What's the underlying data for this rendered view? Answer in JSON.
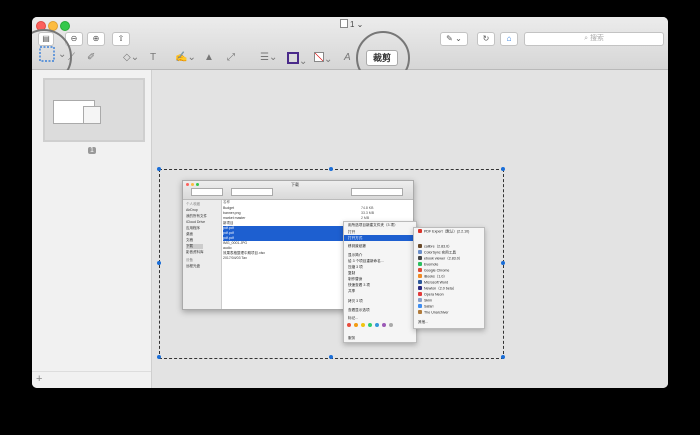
{
  "window": {
    "title": "1",
    "search_placeholder": "搜索",
    "crop_label": "裁剪",
    "page_number": "1",
    "add_symbol": "+"
  },
  "finder": {
    "title": "下载",
    "sidebar": [
      "个人收藏",
      "AirDrop",
      "我的所有文件",
      "iCloud Drive",
      "应用程序",
      "桌面",
      "文稿",
      "下载",
      "影音资料库",
      "设备",
      "远程光盘"
    ],
    "column_header": "名称",
    "files": [
      {
        "name": "Budget",
        "selected": false
      },
      {
        "name": "banner.png",
        "selected": false
      },
      {
        "name": "market master",
        "selected": false
      },
      {
        "name": "新项目",
        "selected": false
      },
      {
        "name": "pdf.pdf",
        "selected": true
      },
      {
        "name": "pdf.pdf",
        "selected": true
      },
      {
        "name": "pdf.pdf",
        "selected": true
      },
      {
        "name": "IMG_0001.JPG",
        "selected": false
      },
      {
        "name": "audio",
        "selected": false
      },
      {
        "name": "效果表格整理中期项目.xlsx",
        "selected": false
      },
      {
        "name": "2017/04/03 Tax",
        "selected": false
      }
    ],
    "sizes": [
      "74.8 KB",
      "33.3 MB",
      "2 MB"
    ]
  },
  "context_menu": {
    "items": [
      "用所选项目新建文件夹（3 项）",
      "打开",
      "打开方式",
      "移到废纸篓",
      "显示简介",
      "给 3 个项目重新命名...",
      "压缩 3 项",
      "复制",
      "制作替身",
      "快速查看 3 项",
      "共享",
      "拷贝 3 项",
      "查看显示选项",
      "标记...",
      "服务"
    ],
    "highlighted": "打开方式"
  },
  "submenu": {
    "items": [
      {
        "name": "PDF Expert（默认）(2.2.10)",
        "color": "#d9342b"
      },
      {
        "name": "calibre（2.83.0）",
        "color": "#6a4a2a"
      },
      {
        "name": "ColorSync 实用工具",
        "color": "#6a8fcb"
      },
      {
        "name": "ebook viewer（2.83.0）",
        "color": "#444444"
      },
      {
        "name": "Evernote",
        "color": "#2dbe60"
      },
      {
        "name": "Google Chrome",
        "color": "#dd4b39"
      },
      {
        "name": "iBooks（1.0）",
        "color": "#f08a24"
      },
      {
        "name": "Microsoft Word",
        "color": "#2b579a"
      },
      {
        "name": "Newton（2.0 beta）",
        "color": "#2a2a80"
      },
      {
        "name": "Opera Neon",
        "color": "#e23a3a"
      },
      {
        "name": "Skim",
        "color": "#8aa0c8"
      },
      {
        "name": "Safari",
        "color": "#3d8df2"
      },
      {
        "name": "The Unarchiver",
        "color": "#b07a3a"
      },
      {
        "name": "其他...",
        "color": "#ffffff"
      }
    ]
  },
  "colors": {
    "selection_blue": "#1a6ed8",
    "tags": [
      "#e74c3c",
      "#f39c12",
      "#f1c40f",
      "#2ecc71",
      "#3498db",
      "#9b59b6",
      "#aaaaaa"
    ]
  }
}
